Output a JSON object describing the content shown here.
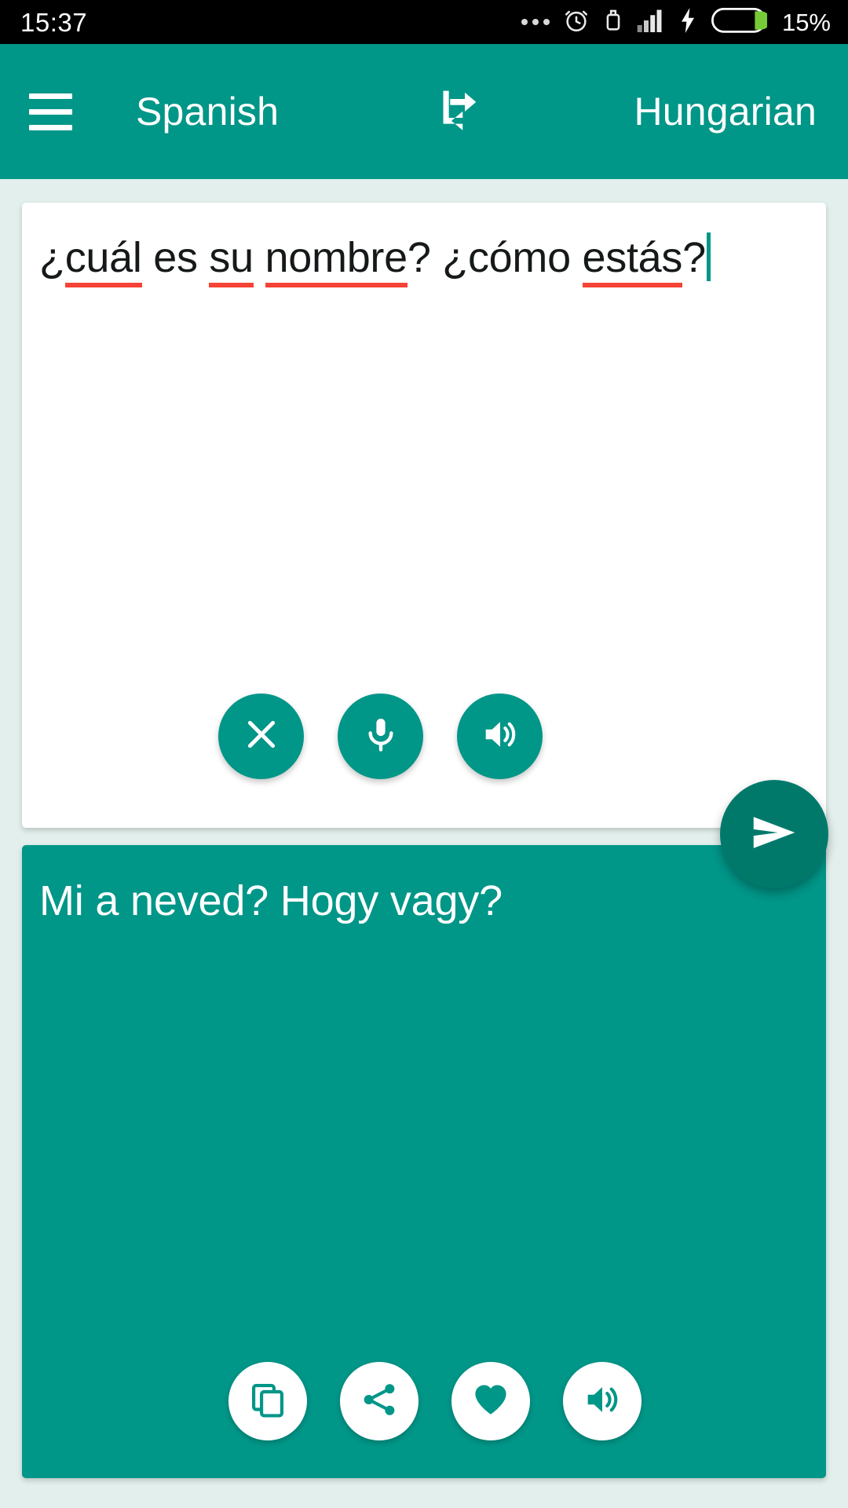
{
  "status_bar": {
    "time": "15:37",
    "battery_percent": "15%",
    "icons": [
      "more-dots-icon",
      "alarm-clock-icon",
      "usb-icon",
      "signal-bars-icon",
      "charging-bolt-icon",
      "battery-icon"
    ]
  },
  "toolbar": {
    "menu_icon": "hamburger-menu-icon",
    "source_language": "Spanish",
    "target_language": "Hungarian",
    "swap_icon": "swap-languages-icon"
  },
  "input_panel": {
    "tokens": [
      {
        "text": "¿",
        "misspelled": false
      },
      {
        "text": "cuál",
        "misspelled": true
      },
      {
        "text": " es ",
        "misspelled": false
      },
      {
        "text": "su",
        "misspelled": true
      },
      {
        "text": " ",
        "misspelled": false
      },
      {
        "text": "nombre",
        "misspelled": true
      },
      {
        "text": "? ¿cómo ",
        "misspelled": false
      },
      {
        "text": "estás",
        "misspelled": true
      },
      {
        "text": "?",
        "misspelled": false
      }
    ],
    "full_text": "¿cuál es su nombre? ¿cómo estás?",
    "caret_visible": true,
    "actions": [
      {
        "name": "clear-button",
        "icon": "close-x-icon"
      },
      {
        "name": "microphone-button",
        "icon": "microphone-icon"
      },
      {
        "name": "speak-input-button",
        "icon": "speaker-icon"
      }
    ]
  },
  "send_button": {
    "name": "send-button",
    "icon": "send-arrow-icon"
  },
  "output_panel": {
    "translated_text": "Mi a neved? Hogy vagy?",
    "actions": [
      {
        "name": "copy-button",
        "icon": "copy-icon"
      },
      {
        "name": "share-button",
        "icon": "share-icon"
      },
      {
        "name": "favorite-button",
        "icon": "heart-icon"
      },
      {
        "name": "speak-output-button",
        "icon": "speaker-icon"
      }
    ]
  },
  "colors": {
    "primary": "#009688",
    "primary_dark": "#00796b",
    "background": "#e2efec",
    "card_white": "#ffffff",
    "spellcheck_red": "#f44336",
    "battery_green": "#76ca36",
    "status_bar": "#000000"
  }
}
